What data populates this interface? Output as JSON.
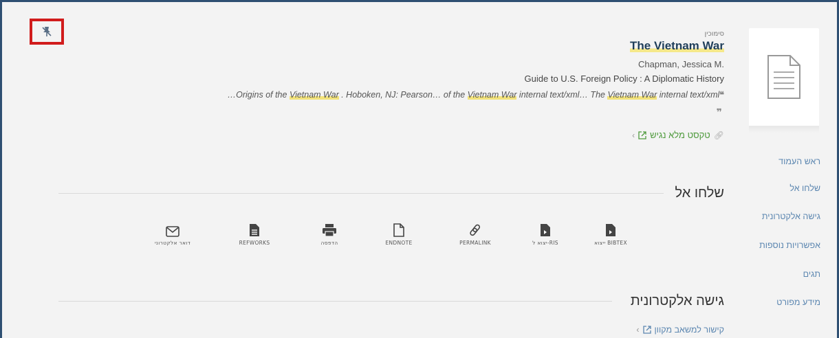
{
  "pin": {
    "icon": "unpin-icon",
    "highlight_color": "#d11c1c"
  },
  "record": {
    "type": "סימוכין",
    "title": "The Vietnam War",
    "author": "Chapman, Jessica M.",
    "source": "Guide to U.S. Foreign Policy : A Diplomatic History",
    "snippet": {
      "p1": "…Origins of the ",
      "h1": "Vietnam War",
      "p2": " . Hoboken, NJ: Pearson… of the ",
      "h2": "Vietnam War",
      "p3": " internal text/xml… The ",
      "h3": "Vietnam War",
      "p4": " internal text/xml",
      "open_quote": "❝",
      "close_quote": "❞"
    },
    "full_text_link": "טקסט מלא נגיש"
  },
  "nav": {
    "items": [
      "ראש העמוד",
      "שלחו אל",
      "גישה אלקטרונית",
      "אפשרויות נוספות",
      "תגים",
      "מידע מפורט"
    ]
  },
  "send_to": {
    "title": "שלחו אל",
    "actions": [
      {
        "label": "דואר אלקטרוני",
        "icon": "mail-icon"
      },
      {
        "label": "REFWORKS",
        "icon": "document-icon"
      },
      {
        "label": "הדפסה",
        "icon": "printer-icon"
      },
      {
        "label": "ENDNOTE",
        "icon": "file-icon"
      },
      {
        "label": "PERMALINK",
        "icon": "link-icon"
      },
      {
        "label": "יצוא ל-RIS",
        "icon": "export-file-icon"
      },
      {
        "label": "ייצוא BIBTEX",
        "icon": "export-file-icon"
      }
    ]
  },
  "electronic_access": {
    "title": "גישה אלקטרונית",
    "link": "קישור למשאב מקוון"
  },
  "colors": {
    "accent_link": "#5b86b0",
    "full_text_green": "#4e9a3c",
    "title": "#1f3e5a",
    "highlight": "#f2e27a",
    "frame": "#2f4f72"
  }
}
